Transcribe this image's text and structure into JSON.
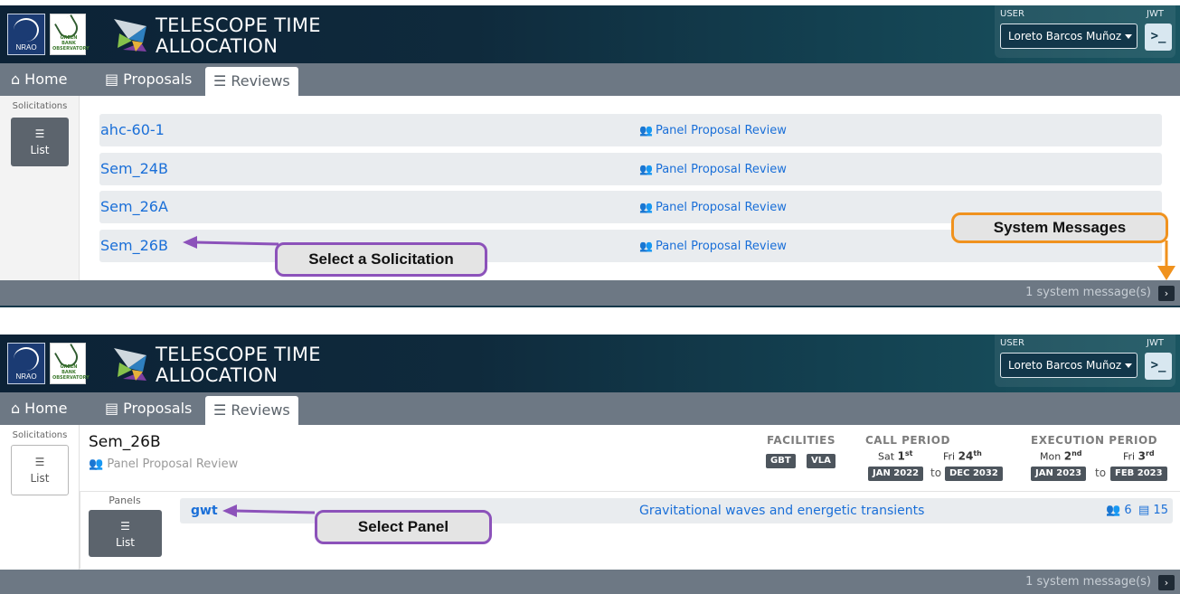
{
  "app": {
    "title": "TELESCOPE TIME\nALLOCATION",
    "logo_nrao_text": "NRAO",
    "logo_gbo_text": "GREEN BANK OBSERVATORY",
    "user_caption": "USER",
    "jwt_caption": "JWT",
    "user_name": "Loreto Barcos Muñoz",
    "jwt_symbol": ">_"
  },
  "nav": {
    "home": "Home",
    "proposals": "Proposals",
    "reviews": "Reviews"
  },
  "sidebar": {
    "title": "Solicitations",
    "list_label": "List",
    "panels_title": "Panels"
  },
  "solicitations": [
    {
      "name": "ahc-60-1",
      "type": "Panel Proposal Review"
    },
    {
      "name": "Sem_24B",
      "type": "Panel Proposal Review"
    },
    {
      "name": "Sem_26A",
      "type": "Panel Proposal Review"
    },
    {
      "name": "Sem_26B",
      "type": "Panel Proposal Review"
    }
  ],
  "footer": {
    "message": "1 system message(s)",
    "arrow": "›"
  },
  "callouts": {
    "select_solicitation": "Select a Solicitation",
    "system_messages": "System Messages",
    "select_panel": "Select Panel"
  },
  "detail": {
    "title": "Sem_26B",
    "subtitle": "Panel Proposal Review",
    "facilities_label": "FACILITIES",
    "facilities": [
      "GBT",
      "VLA"
    ],
    "call_period_label": "CALL PERIOD",
    "call_start_dow": "Sat",
    "call_start_day": "1",
    "call_start_suffix": "st",
    "call_start_month": "JAN 2022",
    "call_end_dow": "Fri",
    "call_end_day": "24",
    "call_end_suffix": "th",
    "call_end_month": "DEC 2032",
    "execution_period_label": "EXECUTION PERIOD",
    "exec_start_dow": "Mon",
    "exec_start_day": "2",
    "exec_start_suffix": "nd",
    "exec_start_month": "JAN 2023",
    "exec_end_dow": "Fri",
    "exec_end_day": "3",
    "exec_end_suffix": "rd",
    "exec_end_month": "FEB 2023",
    "to_word": "to"
  },
  "panel": {
    "name": "gwt",
    "description": "Gravitational waves and energetic transients",
    "reviewers": "6",
    "proposals": "15"
  },
  "colors": {
    "link": "#1a6fd8",
    "callout_purple": "#8c52ba",
    "callout_orange": "#f0921e",
    "navbar": "#6d7884"
  }
}
